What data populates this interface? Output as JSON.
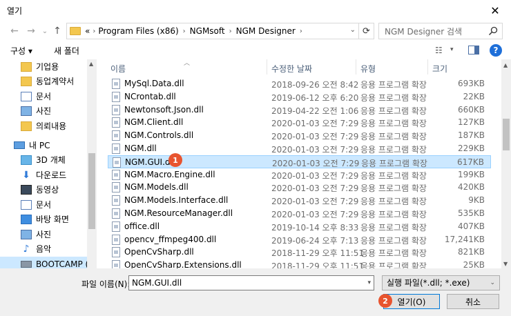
{
  "window": {
    "title": "열기",
    "close": "✕"
  },
  "nav": {
    "back": "←",
    "forward": "→",
    "dropdown": "⌄",
    "up": "↑",
    "breadcrumb": [
      "«",
      "Program Files (x86)",
      "NGMsoft",
      "NGM Designer"
    ],
    "breadcrumb_sep": "›",
    "address_drop": "⌄",
    "refresh": "⟳",
    "search_placeholder": "NGM Designer 검색"
  },
  "toolbar": {
    "organize": "구성 ▾",
    "new_folder": "새 폴더",
    "view_icon": "☷",
    "view_drop": "▾",
    "help": "?"
  },
  "sidebar": {
    "items": [
      {
        "label": "기업용",
        "icon": "folder"
      },
      {
        "label": "동업계약서",
        "icon": "folder"
      },
      {
        "label": "문서",
        "icon": "doc"
      },
      {
        "label": "사진",
        "icon": "img"
      },
      {
        "label": "의뢰내용",
        "icon": "folder"
      },
      {
        "label": "내 PC",
        "icon": "pc"
      },
      {
        "label": "3D 개체",
        "icon": "3d"
      },
      {
        "label": "다운로드",
        "icon": "down"
      },
      {
        "label": "동영상",
        "icon": "video"
      },
      {
        "label": "문서",
        "icon": "doc"
      },
      {
        "label": "바탕 화면",
        "icon": "desk"
      },
      {
        "label": "사진",
        "icon": "img"
      },
      {
        "label": "음악",
        "icon": "music"
      },
      {
        "label": "BOOTCAMP (C:)",
        "icon": "drive"
      }
    ]
  },
  "columns": {
    "name": "이름",
    "date": "수정한 날짜",
    "type": "유형",
    "size": "크기"
  },
  "files": [
    {
      "name": "MySql.Data.dll",
      "date": "2018-09-26 오전 8:42",
      "type": "응용 프로그램 확장",
      "size": "693KB"
    },
    {
      "name": "NCrontab.dll",
      "date": "2019-06-12 오후 6:20",
      "type": "응용 프로그램 확장",
      "size": "22KB"
    },
    {
      "name": "Newtonsoft.Json.dll",
      "date": "2019-04-22 오전 1:06",
      "type": "응용 프로그램 확장",
      "size": "660KB"
    },
    {
      "name": "NGM.Client.dll",
      "date": "2020-01-03 오전 7:29",
      "type": "응용 프로그램 확장",
      "size": "127KB"
    },
    {
      "name": "NGM.Controls.dll",
      "date": "2020-01-03 오전 7:29",
      "type": "응용 프로그램 확장",
      "size": "187KB"
    },
    {
      "name": "NGM.dll",
      "date": "2020-01-03 오전 7:29",
      "type": "응용 프로그램 확장",
      "size": "229KB"
    },
    {
      "name": "NGM.GUI.dll",
      "date": "2020-01-03 오전 7:29",
      "type": "응용 프로그램 확장",
      "size": "617KB"
    },
    {
      "name": "NGM.Macro.Engine.dll",
      "date": "2020-01-03 오전 7:29",
      "type": "응용 프로그램 확장",
      "size": "199KB"
    },
    {
      "name": "NGM.Models.dll",
      "date": "2020-01-03 오전 7:29",
      "type": "응용 프로그램 확장",
      "size": "420KB"
    },
    {
      "name": "NGM.Models.Interface.dll",
      "date": "2020-01-03 오전 7:29",
      "type": "응용 프로그램 확장",
      "size": "9KB"
    },
    {
      "name": "NGM.ResourceManager.dll",
      "date": "2020-01-03 오전 7:29",
      "type": "응용 프로그램 확장",
      "size": "535KB"
    },
    {
      "name": "office.dll",
      "date": "2019-10-14 오후 8:33",
      "type": "응용 프로그램 확장",
      "size": "407KB"
    },
    {
      "name": "opencv_ffmpeg400.dll",
      "date": "2019-06-24 오후 7:13",
      "type": "응용 프로그램 확장",
      "size": "17,241KB"
    },
    {
      "name": "OpenCvSharp.dll",
      "date": "2018-11-29 오후 11:51",
      "type": "응용 프로그램 확장",
      "size": "821KB"
    },
    {
      "name": "OpenCvSharp.Extensions.dll",
      "date": "2018-11-29 오후 11:51",
      "type": "응용 프로그램 확장",
      "size": "25KB"
    }
  ],
  "selected_file_index": 6,
  "bottom": {
    "filename_label": "파일 이름(N):",
    "filename_value": "NGM.GUI.dll",
    "filetype_value": "실행 파일(*.dll; *.exe)",
    "open_button": "열기(O)",
    "cancel_button": "취소"
  },
  "badges": {
    "step1": "1",
    "step2": "2"
  },
  "colors": {
    "selection": "#cce8ff",
    "badge": "#e8542f",
    "accent": "#0078d7"
  }
}
